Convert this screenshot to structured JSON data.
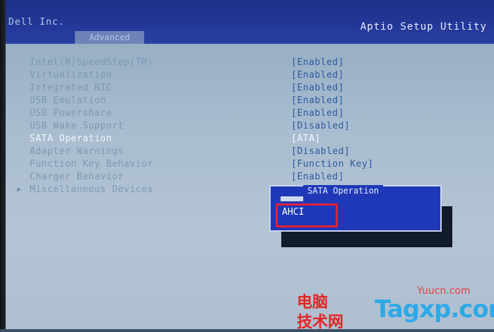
{
  "header": {
    "brand": "Dell Inc.",
    "utility_title": "Aptio Setup Utility",
    "tabs": [
      {
        "label": "Advanced",
        "active": true
      }
    ]
  },
  "menu": {
    "items": [
      {
        "label": "Intel(R)SpeedStep(TM)",
        "value": "[Enabled]"
      },
      {
        "label": "Virtualization",
        "value": "[Enabled]"
      },
      {
        "label": "Integrated NIC",
        "value": "[Enabled]"
      },
      {
        "label": "USB Emulation",
        "value": "[Enabled]"
      },
      {
        "label": "USB Powershare",
        "value": "[Enabled]"
      },
      {
        "label": "USB Wake Support",
        "value": "[Disabled]"
      },
      {
        "label": "SATA Operation",
        "value": "[ATA]",
        "selected": true
      },
      {
        "label": "Adapter Warnings",
        "value": "[Disabled]"
      },
      {
        "label": "Function Key Behavior",
        "value": "[Function Key]"
      },
      {
        "label": "Charger Behavior",
        "value": "[Enabled]"
      },
      {
        "label": "Miscellaneous Devices",
        "value": "",
        "submenu": true
      }
    ]
  },
  "popup": {
    "title": "SATA Operation",
    "previous_option": "ATA",
    "option": "AHCI"
  },
  "watermark": {
    "cn_line1": "电脑",
    "cn_line2": "技术网",
    "url": "Yuucn.com",
    "brand": "Tagxp.com"
  },
  "colors": {
    "header_blue": "#24389a",
    "popup_blue": "#1e38b8",
    "highlight_red": "#e0203c"
  }
}
